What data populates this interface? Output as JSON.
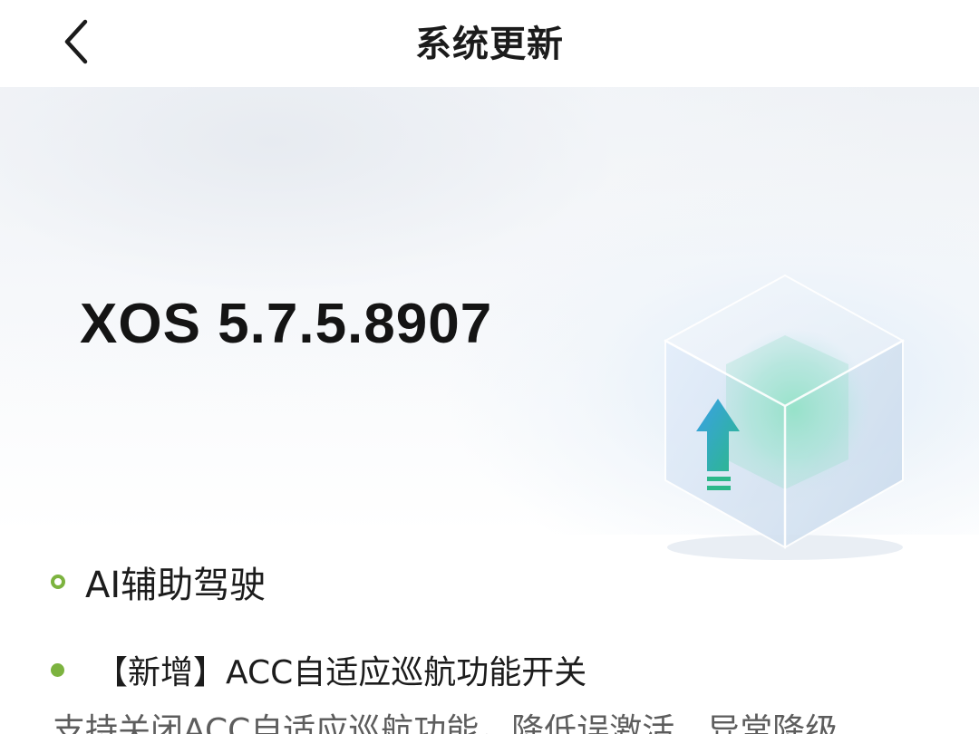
{
  "header": {
    "title": "系统更新",
    "back_icon": "chevron-left-icon"
  },
  "hero": {
    "version": "XOS 5.7.5.8907",
    "illustration_icon": "update-cube-icon"
  },
  "release_notes": {
    "section_title": "AI辅助驾驶",
    "items": [
      {
        "title": "【新增】ACC自适应巡航功能开关",
        "description": "支持关闭ACC自适应巡航功能，降低误激活、异常降级"
      }
    ]
  },
  "colors": {
    "accent": "#7cb33f",
    "arrow_green": "#2cb88a",
    "title_text": "#1b1b1b",
    "description_text": "#5d5d5d"
  }
}
